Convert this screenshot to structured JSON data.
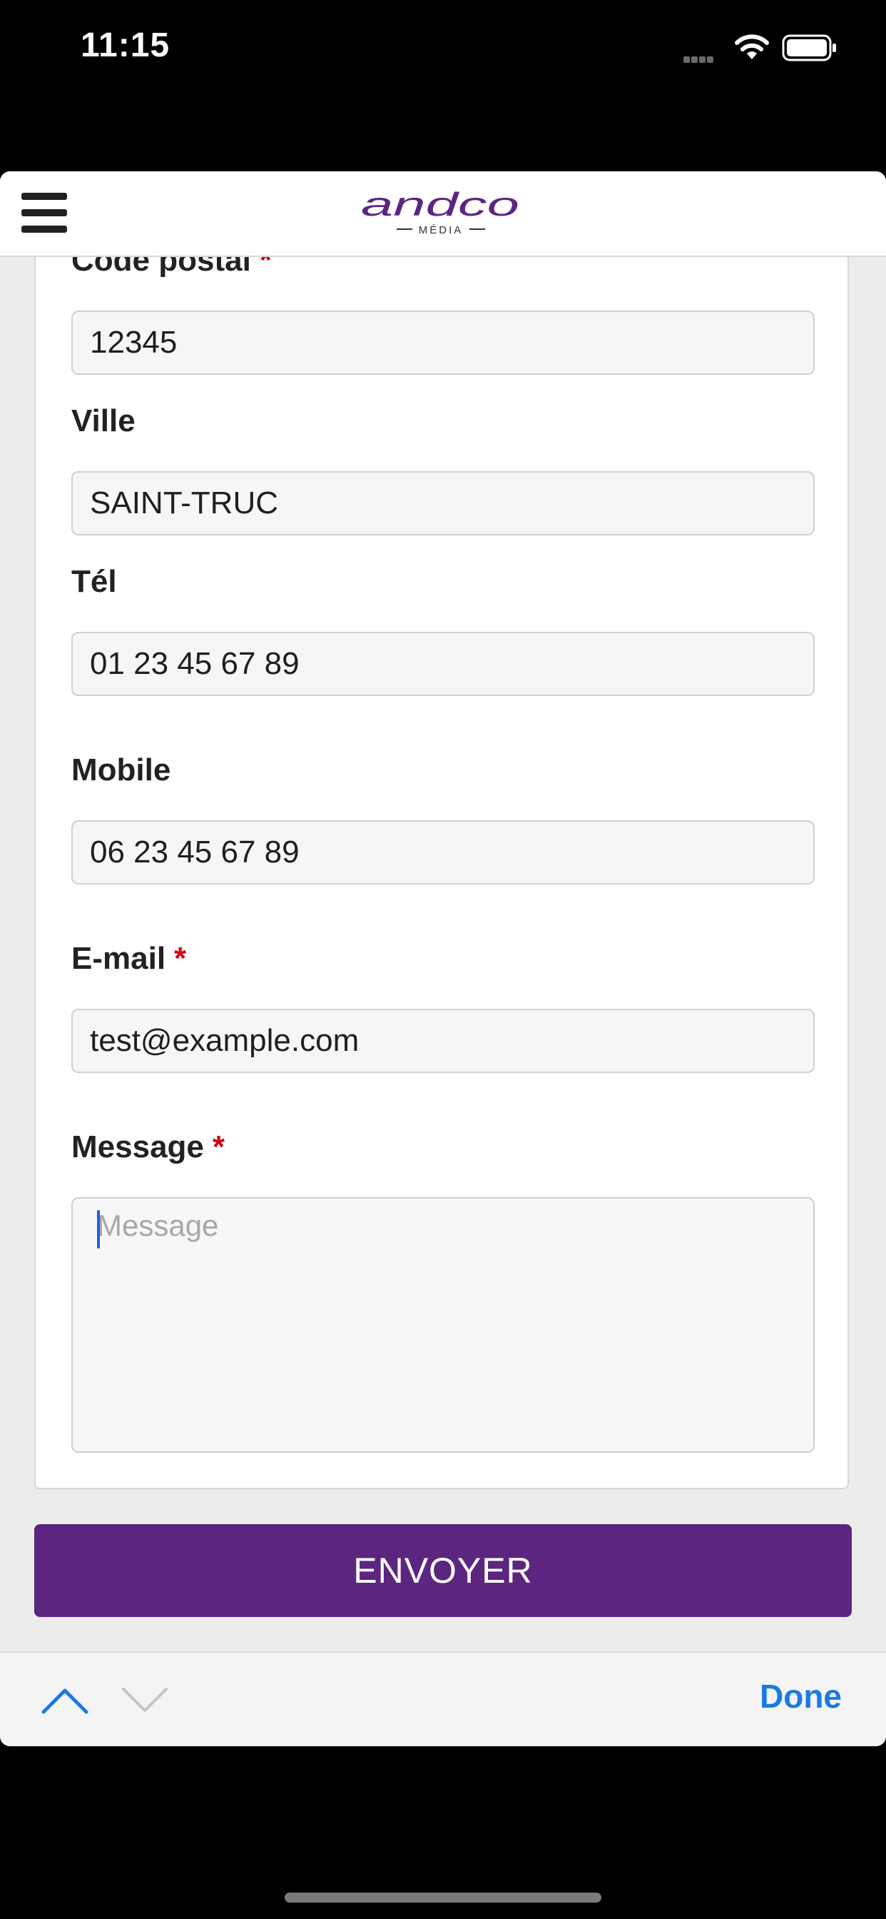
{
  "status_bar": {
    "time": "11:15"
  },
  "header": {
    "logo_text": "andco",
    "logo_subtext": "MÉDIA"
  },
  "form": {
    "postal_code": {
      "label": "Code postal",
      "required_mark": "*",
      "value": "12345"
    },
    "city": {
      "label": "Ville",
      "value": "SAINT-TRUC"
    },
    "phone": {
      "label": "Tél",
      "value": "01 23 45 67 89"
    },
    "mobile": {
      "label": "Mobile",
      "value": "06 23 45 67 89"
    },
    "email": {
      "label": "E-mail",
      "required_mark": "*",
      "value": "test@example.com"
    },
    "message": {
      "label": "Message",
      "required_mark": "*",
      "placeholder": "Message",
      "value": ""
    },
    "submit_label": "ENVOYER"
  },
  "accessory_bar": {
    "done_label": "Done"
  },
  "colors": {
    "brand_purple": "#5c2680",
    "required_red": "#d0021b",
    "link_blue": "#1a7ae0"
  }
}
